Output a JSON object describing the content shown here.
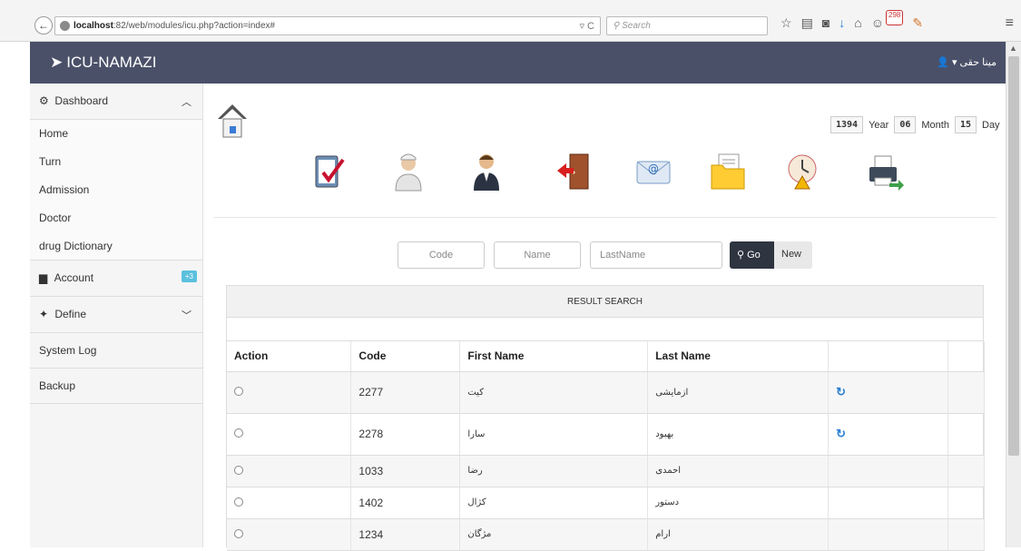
{
  "browser": {
    "url_host": "localhost",
    "url_rest": ":82/web/modules/icu.php?action=index#",
    "search_placeholder": "Search",
    "notification_count": "298"
  },
  "navbar": {
    "brand": "ICU-NAMAZI",
    "user": "▾ مینا حقی"
  },
  "sidebar": {
    "dashboard": "Dashboard",
    "items": [
      "Home",
      "Turn",
      "Admission",
      "Doctor",
      "drug Dictionary"
    ],
    "account": "Account",
    "account_badge": "+3",
    "define": "Define",
    "system_log": "System Log",
    "backup": "Backup"
  },
  "date": {
    "year": "1394",
    "year_label": "Year",
    "month": "06",
    "month_label": "Month",
    "day": "15",
    "day_label": "Day"
  },
  "search": {
    "code_placeholder": "Code",
    "name_placeholder": "Name",
    "lastname_placeholder": "LastName",
    "go_label": "Go",
    "new_label": "New"
  },
  "result": {
    "title": "RESULT SEARCH",
    "columns": [
      "Action",
      "Code",
      "First Name",
      "Last Name",
      "",
      ""
    ],
    "rows": [
      {
        "code": "2277",
        "first": "کیت",
        "last": "ازمایشی"
      },
      {
        "code": "2278",
        "first": "سارا",
        "last": "بهبود"
      },
      {
        "code": "1033",
        "first": "رضا",
        "last": "احمدی"
      },
      {
        "code": "1402",
        "first": "کژال",
        "last": "دستور"
      },
      {
        "code": "1234",
        "first": "مژگان",
        "last": "ارام"
      }
    ]
  }
}
